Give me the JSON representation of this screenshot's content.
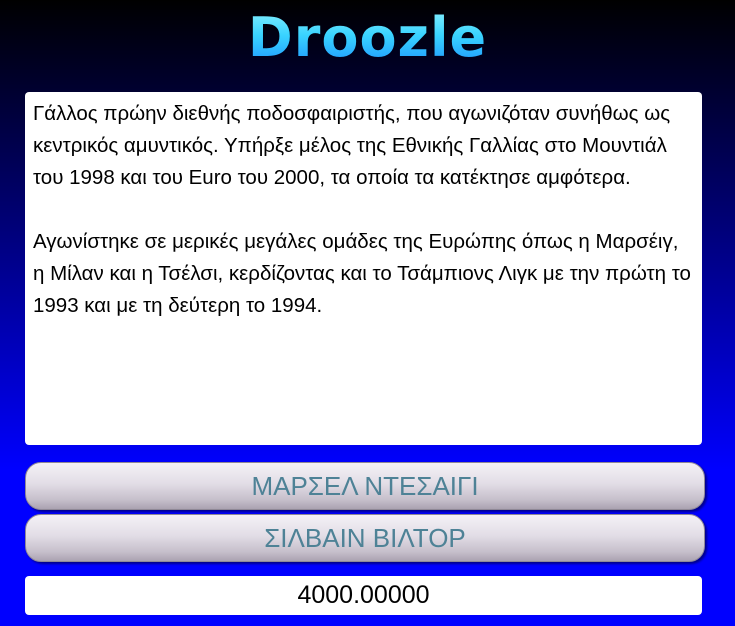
{
  "app": {
    "title": "Droozle"
  },
  "clue": {
    "paragraph_1": "Γάλλος πρώην διεθνής ποδοσφαιριστής, που αγωνιζόταν συνήθως ως κεντρικός αμυντικός. Υπήρξε μέλος της Εθνικής Γαλλίας στο Μουντιάλ του 1998 και του Euro του 2000, τα οποία τα κατέκτησε αμφότερα.",
    "paragraph_2": "Αγωνίστηκε σε μερικές μεγάλες ομάδες της Ευρώπης όπως η Μαρσέιγ, η Μίλαν και η Τσέλσι, κερδίζοντας και το Τσάμπιονς Λιγκ με την πρώτη το 1993 και με τη δεύτερη το 1994."
  },
  "answers": [
    {
      "label": "ΜΑΡΣΕΛ ΝΤΕΣΑΙΓΙ"
    },
    {
      "label": "ΣΙΛΒΑΙΝ ΒΙΛΤΟΡ"
    }
  ],
  "score": {
    "value": "4000.00000"
  },
  "colors": {
    "logo": "#2ec8ff",
    "background_bottom": "#0000ff",
    "answer_text": "#4e8296"
  }
}
